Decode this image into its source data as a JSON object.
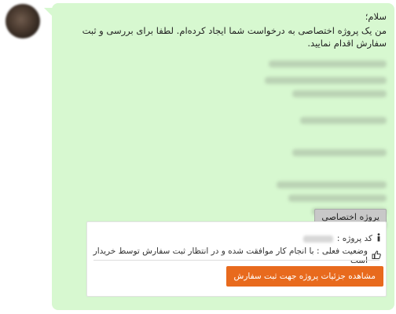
{
  "message": {
    "greeting": "سلام؛",
    "intro": "من یک پروژه اختصاصی به درخواست شما ایجاد کرده‌ام. لطفا برای بررسی و ثبت سفارش اقدام نمایید."
  },
  "project_tag": {
    "label": "پروژه اختصاصی"
  },
  "card": {
    "code_label": "کد پروژه :",
    "status_label": "وضعیت فعلی : با انجام کار موافقت شده و در انتظار ثبت سفارش توسط خریدار است",
    "action_button": "مشاهده جزئیات پروژه جهت ثبت سفارش"
  },
  "icons": {
    "info": "info-icon",
    "status": "thumbs-up-icon"
  },
  "colors": {
    "bubble_bg": "#d7f8d0",
    "button_bg": "#e86a1d",
    "tag_bg": "#c8c8c8"
  }
}
